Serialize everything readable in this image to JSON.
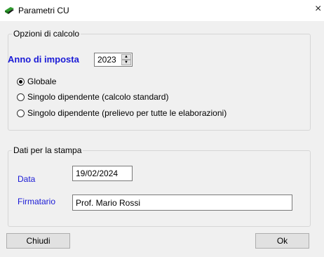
{
  "window": {
    "title": "Parametri CU",
    "close_glyph": "×"
  },
  "calc_group": {
    "legend": "Opzioni di calcolo",
    "year_label": "Anno di imposta",
    "year_value": "2023",
    "options": [
      {
        "label": "Globale",
        "checked": true
      },
      {
        "label": "Singolo dipendente (calcolo standard)",
        "checked": false
      },
      {
        "label": "Singolo dipendente (prelievo per tutte le elaborazioni)",
        "checked": false
      }
    ]
  },
  "print_group": {
    "legend": "Dati per la stampa",
    "date_label": "Data",
    "date_value": "19/02/2024",
    "signer_label": "Firmatario",
    "signer_value": "Prof. Mario Rossi"
  },
  "buttons": {
    "close_label": "Chiudi",
    "ok_label": "Ok"
  },
  "colors": {
    "accent_label": "#1a1ad6",
    "background": "#f0f0f0"
  },
  "icons": {
    "app": "green-book-icon",
    "close": "close-icon",
    "spin_up": "spin-up-icon",
    "spin_down": "spin-down-icon"
  }
}
